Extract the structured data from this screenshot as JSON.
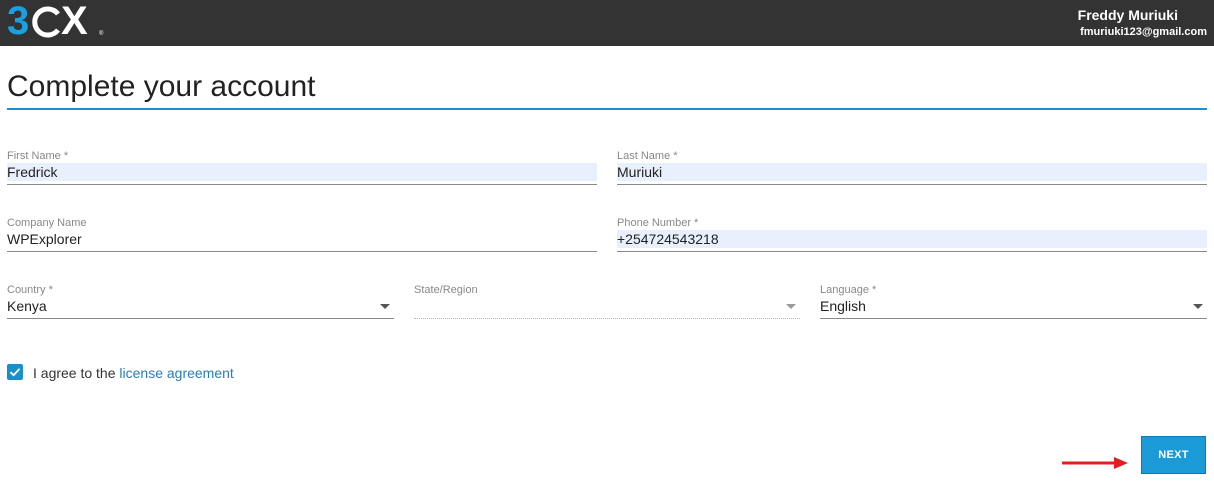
{
  "header": {
    "logo_text_prefix": "3",
    "logo_text_suffix": "X",
    "logo_trademark": "®",
    "user_name": "Freddy Muriuki",
    "user_email": "fmuriuki123@gmail.com"
  },
  "page": {
    "title": "Complete your account"
  },
  "form": {
    "first_name": {
      "label": "First Name *",
      "value": "Fredrick"
    },
    "last_name": {
      "label": "Last Name *",
      "value": "Muriuki"
    },
    "company_name": {
      "label": "Company Name",
      "value": "WPExplorer"
    },
    "phone_number": {
      "label": "Phone Number *",
      "value": "+254724543218"
    },
    "country": {
      "label": "Country *",
      "value": "Kenya"
    },
    "state_region": {
      "label": "State/Region",
      "value": ""
    },
    "language": {
      "label": "Language *",
      "value": "English"
    }
  },
  "agreement": {
    "checked": true,
    "text": "I agree to the ",
    "link_text": "license agreement"
  },
  "actions": {
    "next_label": "NEXT"
  },
  "colors": {
    "topbar": "#333333",
    "accent": "#1a9ad6",
    "autofill": "#e8f0fe",
    "annotation_arrow": "#e02020"
  },
  "icons": {
    "checkbox": "check-icon",
    "dropdown": "chevron-down-icon",
    "annotation": "arrow-right-icon"
  }
}
